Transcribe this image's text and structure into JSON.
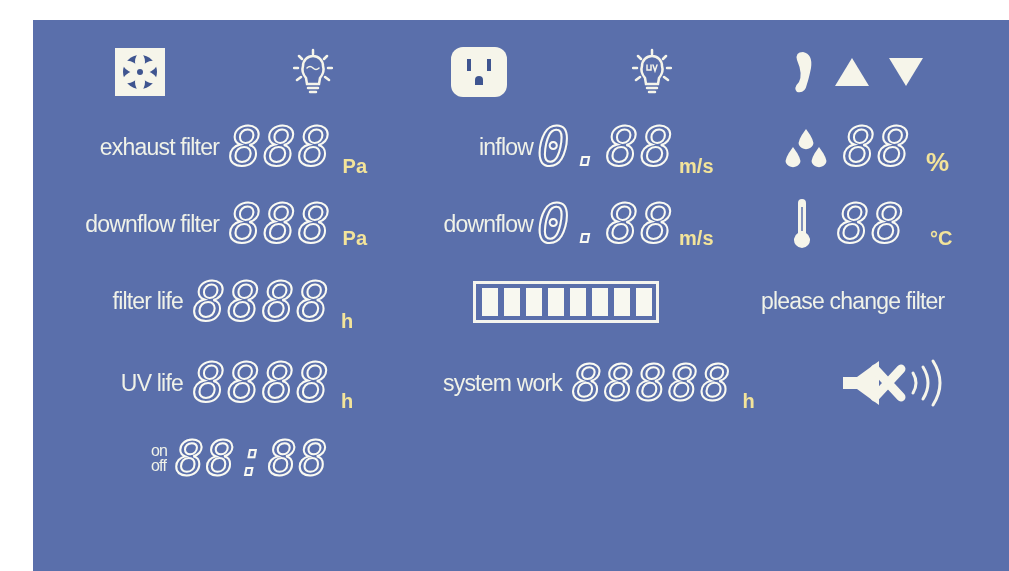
{
  "left": [
    {
      "label": "exhaust filter",
      "value": "888",
      "unit": "Pa"
    },
    {
      "label": "downflow filter",
      "value": "888",
      "unit": "Pa"
    },
    {
      "label": "filter life",
      "value": "8888",
      "unit": "h"
    },
    {
      "label": "UV life",
      "value": "8888",
      "unit": "h"
    }
  ],
  "timer": {
    "on_label": "on",
    "off_label": "off",
    "value": "88:88"
  },
  "middle": [
    {
      "label": "inflow",
      "value": "0.88",
      "unit": "m/s"
    },
    {
      "label": "downflow",
      "value": "0.88",
      "unit": "m/s"
    }
  ],
  "filter_bar": {
    "level": 1
  },
  "system_work": {
    "label": "system work",
    "value": "88888",
    "unit": "h"
  },
  "humidity": {
    "value": "88",
    "unit": "%"
  },
  "temperature": {
    "value": "88",
    "unit": "°C"
  },
  "message": "please change filter"
}
